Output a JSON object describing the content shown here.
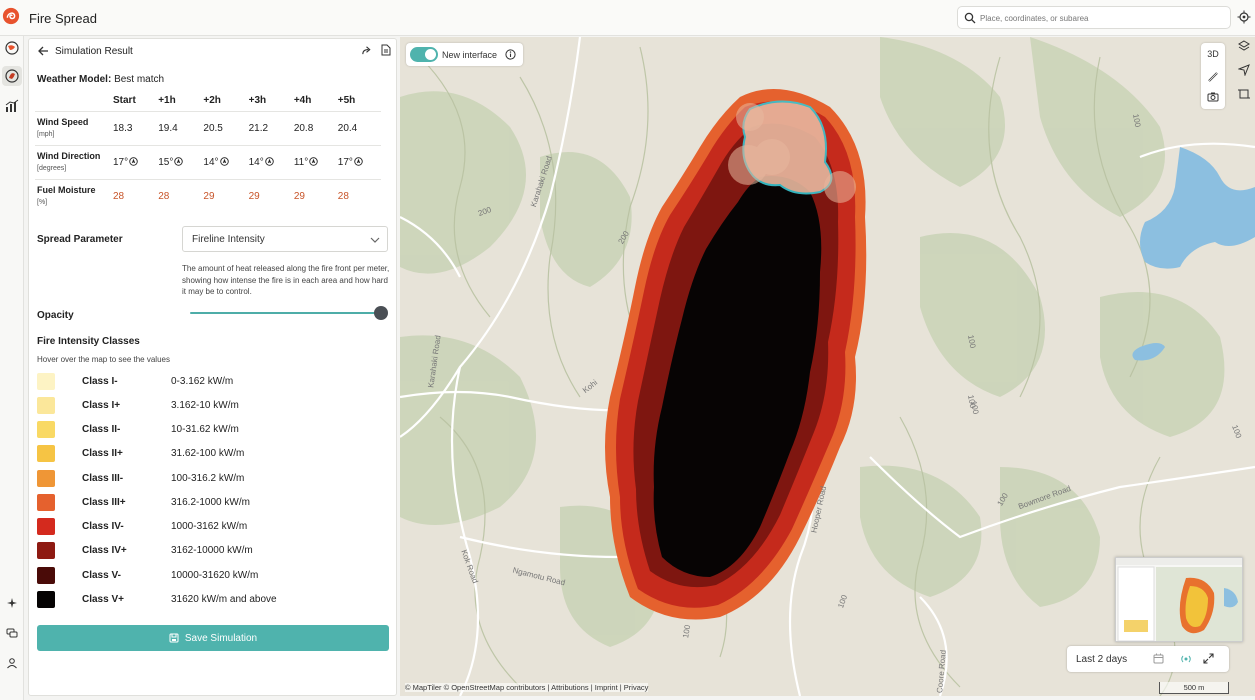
{
  "app": {
    "title": "Fire Spread",
    "search_placeholder": "Place, coordinates, or subarea"
  },
  "panel": {
    "title": "Simulation Result",
    "weather_label": "Weather Model:",
    "weather_value": "Best match",
    "columns": [
      "Start",
      "+1h",
      "+2h",
      "+3h",
      "+4h",
      "+5h"
    ],
    "rows": [
      {
        "label": "Wind Speed",
        "unit": "[mph]",
        "values": [
          "18.3",
          "19.4",
          "20.5",
          "21.2",
          "20.8",
          "20.4"
        ]
      },
      {
        "label": "Wind Direction",
        "unit": "[degrees]",
        "values": [
          "17°",
          "15°",
          "14°",
          "14°",
          "11°",
          "17°"
        ]
      },
      {
        "label": "Fuel Moisture",
        "unit": "[%]",
        "values": [
          "28",
          "28",
          "29",
          "29",
          "29",
          "28"
        ]
      }
    ],
    "spread_label": "Spread Parameter",
    "spread_value": "Fireline Intensity",
    "spread_desc": "The amount of heat released along the fire front per meter, showing how intense the fire is in each area and how hard it may be to control.",
    "opacity_label": "Opacity",
    "opacity_value": 1.0,
    "classes_title": "Fire Intensity Classes",
    "classes_hint": "Hover over the map to see the values",
    "classes": [
      {
        "name": "Class I-",
        "range": "0-3.162 kW/m",
        "color": "#fdf3c4"
      },
      {
        "name": "Class I+",
        "range": "3.162-10 kW/m",
        "color": "#fbe79a"
      },
      {
        "name": "Class II-",
        "range": "10-31.62 kW/m",
        "color": "#f9d964"
      },
      {
        "name": "Class II+",
        "range": "31.62-100 kW/m",
        "color": "#f6c444"
      },
      {
        "name": "Class III-",
        "range": "100-316.2 kW/m",
        "color": "#ef9636"
      },
      {
        "name": "Class III+",
        "range": "316.2-1000 kW/m",
        "color": "#e5612e"
      },
      {
        "name": "Class IV-",
        "range": "1000-3162 kW/m",
        "color": "#d42a1e"
      },
      {
        "name": "Class IV+",
        "range": "3162-10000 kW/m",
        "color": "#8e1a12"
      },
      {
        "name": "Class V-",
        "range": "10000-31620 kW/m",
        "color": "#4a0b08"
      },
      {
        "name": "Class V+",
        "range": "31620 kW/m and above",
        "color": "#050303"
      }
    ],
    "save_label": "Save Simulation"
  },
  "map": {
    "toggle_label": "New interface",
    "btn_3d": "3D",
    "roads": [
      "Karahaki Road",
      "Karahaki Road",
      "Kohi",
      "Hooper Road",
      "Bowmore Road",
      "Kok Road",
      "Ngamotu Road",
      "Coore Road"
    ],
    "contours": [
      "200",
      "200",
      "100",
      "100",
      "100",
      "100",
      "100",
      "100",
      "100",
      "100"
    ],
    "time_label": "Last 2 days",
    "attribution": "© MapTiler © OpenStreetMap contributors | Attributions | Imprint | Privacy",
    "scale": "500 m"
  },
  "colors": {
    "accent": "#4fb3ad",
    "fuel": "#c8552a"
  }
}
